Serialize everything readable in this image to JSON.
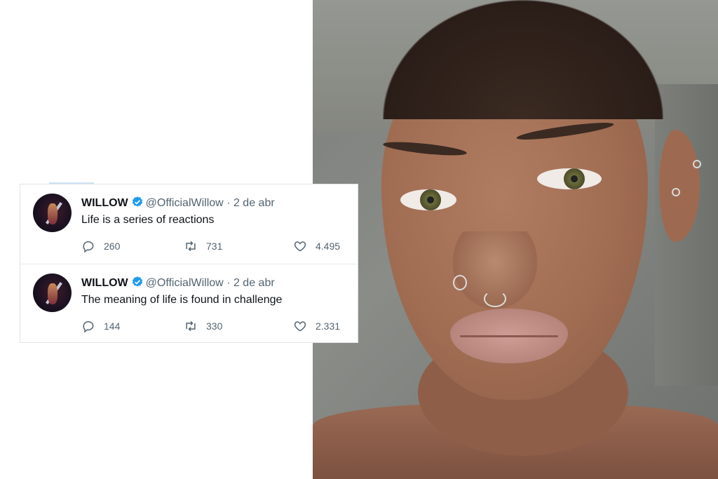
{
  "tweets": [
    {
      "name": "WILLOW",
      "handle": "@OfficialWillow",
      "separator": "·",
      "date": "2 de abr",
      "text": "Life is a series of reactions",
      "replies": "260",
      "retweets": "731",
      "likes": "4.495"
    },
    {
      "name": "WILLOW",
      "handle": "@OfficialWillow",
      "separator": "·",
      "date": "2 de abr",
      "text": "The meaning of life is found in challenge",
      "replies": "144",
      "retweets": "330",
      "likes": "2.331"
    }
  ],
  "icons": {
    "verified": "verified-badge-icon",
    "reply": "reply-icon",
    "retweet": "retweet-icon",
    "like": "heart-icon"
  },
  "colors": {
    "verified_blue": "#1d9bf0",
    "text_primary": "#0f1419",
    "text_secondary": "#536471"
  }
}
